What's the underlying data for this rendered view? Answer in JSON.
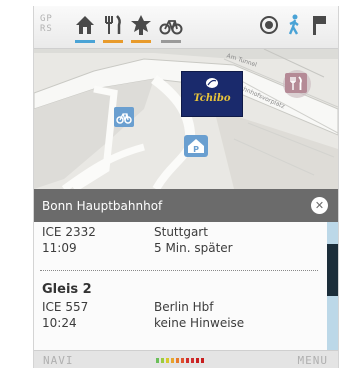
{
  "status": {
    "network_line1": "GP",
    "network_line2": "RS"
  },
  "toolbar": {
    "icons": [
      "home-icon",
      "restaurant-icon",
      "sightseeing-icon",
      "bicycle-icon",
      "location-target-icon",
      "pedestrian-icon",
      "flag-icon"
    ],
    "underline_colors": [
      "#4aa3d6",
      "#e89b2c",
      "#e89b2c",
      "#9a9a9a"
    ]
  },
  "map": {
    "street_label_1": "Am Tunnel",
    "street_label_2": "Bahnhofsvorplatz",
    "brand_logo_text": "Tchibo",
    "poi_colors": {
      "bike": "#6a9fd0",
      "parking": "#6a9fd0",
      "restaurant": "#b58a96"
    }
  },
  "station": {
    "title": "Bonn Hauptbahnhof",
    "close_symbol": "✕"
  },
  "trains": [
    {
      "train": "ICE 2332",
      "time": "11:09",
      "destination": "Stuttgart",
      "info": "5 Min. später"
    },
    {
      "gleis": "Gleis 2",
      "train": "ICE 557",
      "time": "10:24",
      "destination": "Berlin Hbf",
      "info": "keine Hinweise"
    }
  ],
  "bottom": {
    "left_label": "NAVI",
    "right_label": "MENU",
    "signal_colors": [
      "#6bbf59",
      "#9ccc3c",
      "#d6c82c",
      "#e8a42c",
      "#e87a2c",
      "#e0502c",
      "#d02c2c",
      "#d02c2c",
      "#c81e1e",
      "#c81e1e"
    ]
  }
}
